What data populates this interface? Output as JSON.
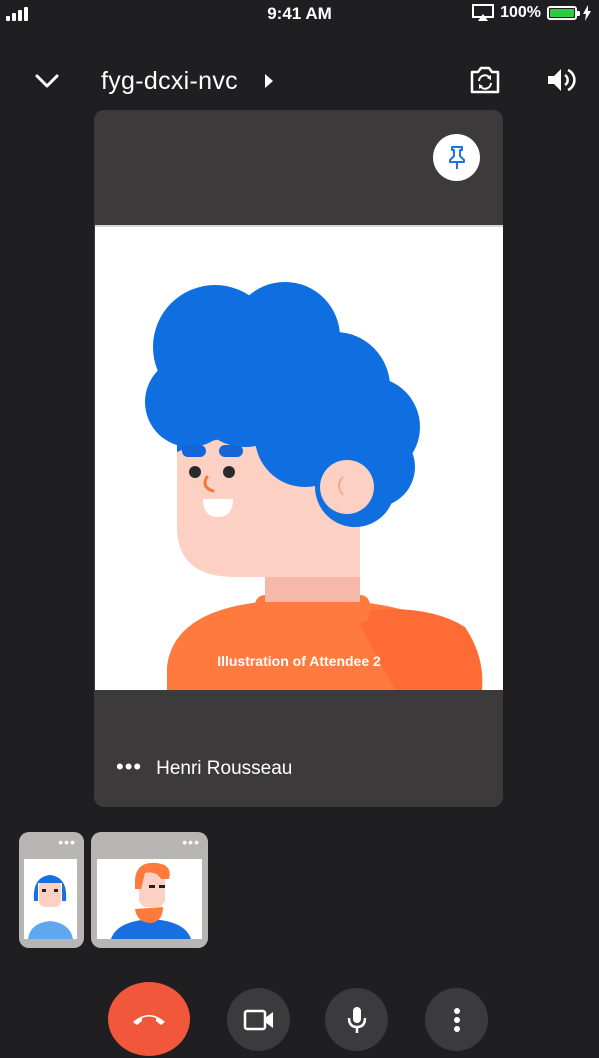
{
  "status_bar": {
    "time": "9:41 AM",
    "battery_percent": "100%",
    "battery_level": 1.0
  },
  "header": {
    "meeting_code": "fyg-dcxi-nvc"
  },
  "main_tile": {
    "participant_name": "Henri Rousseau",
    "illustration_label": "Illustration of Attendee 2",
    "more_label": "•••"
  },
  "thumbnails": [
    {
      "more_label": "•••"
    },
    {
      "more_label": "•••"
    }
  ],
  "icons": {
    "back": "chevron-down-icon",
    "flip_camera": "flip-camera-icon",
    "speaker": "speaker-icon",
    "pin": "pin-icon",
    "end_call": "hang-up-icon",
    "camera": "video-camera-icon",
    "mic": "microphone-icon",
    "more": "more-vertical-icon"
  },
  "colors": {
    "end_call": "#f0573b",
    "pin_blue": "#1a73e8",
    "battery_green": "#2ecc40"
  }
}
